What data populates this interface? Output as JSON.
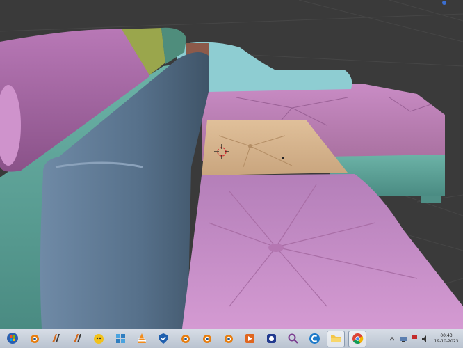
{
  "colors": {
    "viewport_background": "#3a3a3a",
    "grid_line": "#4a4a4a",
    "pink_cushion": "#c88ac9",
    "blue_backrest": "#56708a",
    "teal_frame": "#5aa096",
    "light_blue_arm": "#8ecdd2",
    "tan_cushion": "#d8b48c",
    "olive_roll": "#9aa64c"
  },
  "scene": {
    "cursor_icon": "3d-cursor-icon"
  },
  "taskbar": {
    "apps": [
      {
        "icon": "start-orb-icon",
        "active": false
      },
      {
        "icon": "blender-icon",
        "active": false
      },
      {
        "icon": "tool-icon",
        "active": false
      },
      {
        "icon": "tool-icon",
        "active": false
      },
      {
        "icon": "cat-app-icon",
        "active": false
      },
      {
        "icon": "puzzle-icon",
        "active": false
      },
      {
        "icon": "vlc-icon",
        "active": false
      },
      {
        "icon": "shield-icon",
        "active": false
      },
      {
        "icon": "blender-icon",
        "active": false
      },
      {
        "icon": "blender-icon",
        "active": false
      },
      {
        "icon": "blender-icon",
        "active": false
      },
      {
        "icon": "orange-app-icon",
        "active": false
      },
      {
        "icon": "bird-app-icon",
        "active": false
      },
      {
        "icon": "magnifier-icon",
        "active": false
      },
      {
        "icon": "c-app-icon",
        "active": false
      },
      {
        "icon": "folder-icon",
        "active": true
      },
      {
        "icon": "chrome-icon",
        "active": true
      }
    ],
    "tray": {
      "icons": [
        "arrow-up-icon",
        "network-icon",
        "flag-icon",
        "volume-icon"
      ],
      "time": "00:43",
      "date": "19-10-2023"
    }
  }
}
